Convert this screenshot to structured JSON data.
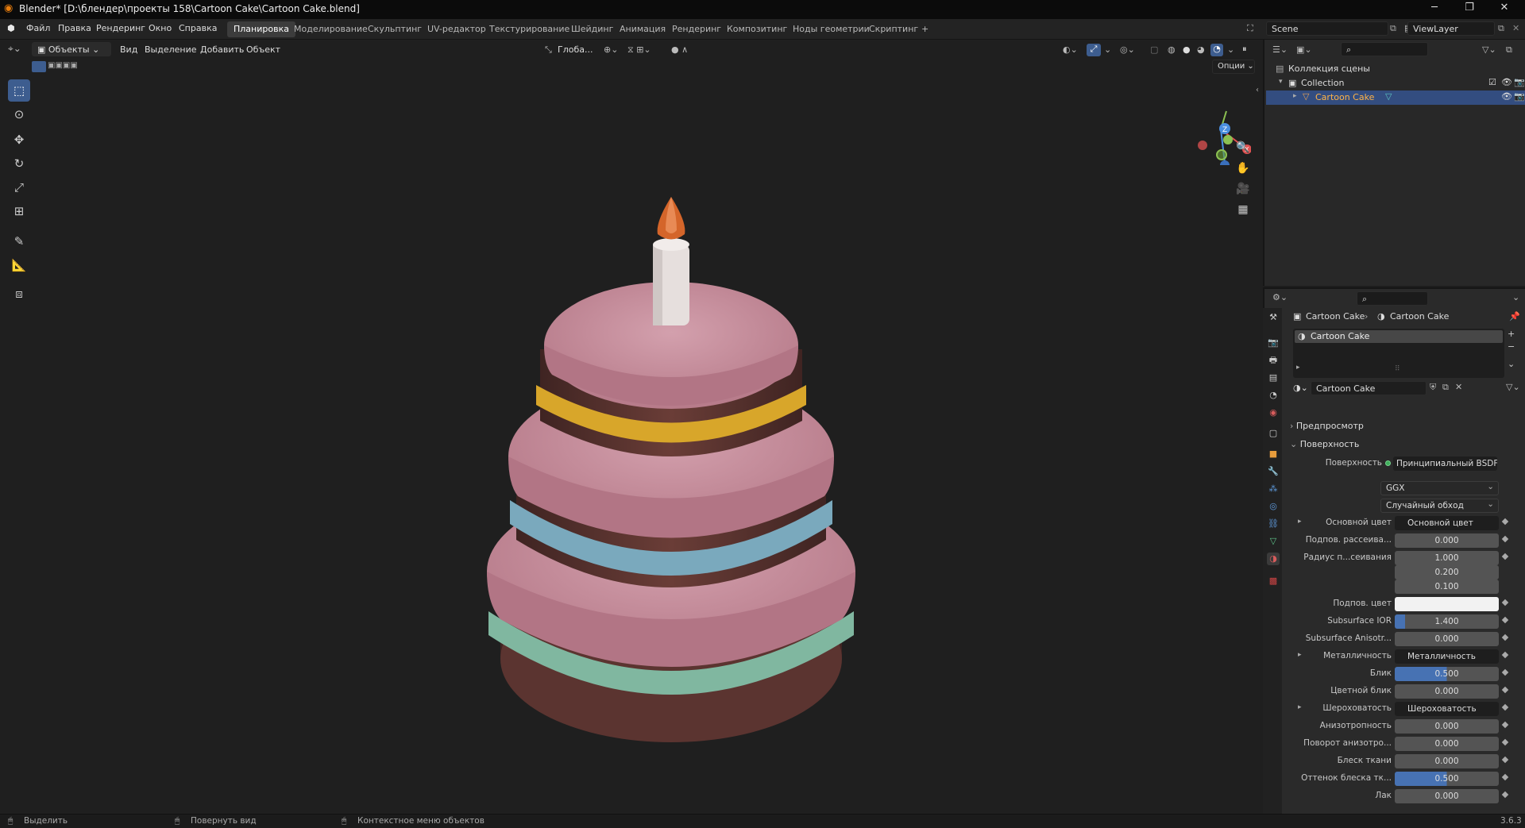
{
  "titlebar": {
    "title": "Blender* [D:\\блендер\\проекты 158\\Cartoon Cake\\Cartoon Cake.blend]"
  },
  "menu": [
    "Файл",
    "Правка",
    "Рендеринг",
    "Окно",
    "Справка"
  ],
  "workspaces": [
    "Планировка",
    "Моделирование",
    "Скульптинг",
    "UV-редактор",
    "Текстурирование",
    "Шейдинг",
    "Анимация",
    "Рендеринг",
    "Композитинг",
    "Ноды геометрии",
    "Скриптинг",
    "+"
  ],
  "active_workspace": "Планировка",
  "scene": {
    "name": "Scene",
    "view_layer": "ViewLayer"
  },
  "viewport_header": {
    "mode": "Объекты",
    "menus": [
      "Вид",
      "Выделение",
      "Добавить",
      "Объект"
    ],
    "orientation": "Глоба...",
    "options": "Опции"
  },
  "outliner": {
    "root": "Коллекция сцены",
    "collection": "Collection",
    "object": "Cartoon Cake"
  },
  "properties": {
    "breadcrumb_object": "Cartoon Cake",
    "breadcrumb_material": "Cartoon Cake",
    "material_slot": "Cartoon Cake",
    "material_name": "Cartoon Cake",
    "panel_preview": "Предпросмотр",
    "panel_surface": "Поверхность",
    "surface_label": "Поверхность",
    "surface_value": "Принципиальный BSDF",
    "distribution": "GGX",
    "subsurface_method": "Случайный обход",
    "rows": [
      {
        "label": "Основной цвет",
        "link": "Основной цвет",
        "expand": true
      },
      {
        "label": "Подпов. рассеива...",
        "value": "0.000"
      },
      {
        "label": "Радиус п...сеивания",
        "value": "1.000"
      },
      {
        "label": "",
        "value": "0.200"
      },
      {
        "label": "",
        "value": "0.100"
      },
      {
        "label": "Подпов. цвет",
        "color": "#f2f2f2"
      },
      {
        "label": "Subsurface IOR",
        "value": "1.400"
      },
      {
        "label": "Subsurface Anisotr...",
        "value": "0.000"
      },
      {
        "label": "Металличность",
        "link": "Металличность",
        "expand": true
      },
      {
        "label": "Блик",
        "value": "0.500",
        "fill": 0.5
      },
      {
        "label": "Цветной блик",
        "value": "0.000"
      },
      {
        "label": "Шероховатость",
        "link": "Шероховатость",
        "expand": true
      },
      {
        "label": "Анизотропность",
        "value": "0.000"
      },
      {
        "label": "Поворот анизотро...",
        "value": "0.000"
      },
      {
        "label": "Блеск ткани",
        "value": "0.000"
      },
      {
        "label": "Оттенок блеска тк...",
        "value": "0.500",
        "fill": 0.5
      },
      {
        "label": "Лак",
        "value": "0.000"
      }
    ]
  },
  "statusbar": {
    "select": "Выделить",
    "rotate": "Повернуть вид",
    "context": "Контекстное меню объектов",
    "version": "3.6.3"
  },
  "colors": {
    "accent": "#4772b3",
    "cake_frosting": "#c88d9a",
    "cake_body": "#5a3530",
    "band_yellow": "#d8a62a",
    "band_blue": "#7aa9bd",
    "band_green": "#80b7a0",
    "candle_flame": "#d4652a"
  }
}
